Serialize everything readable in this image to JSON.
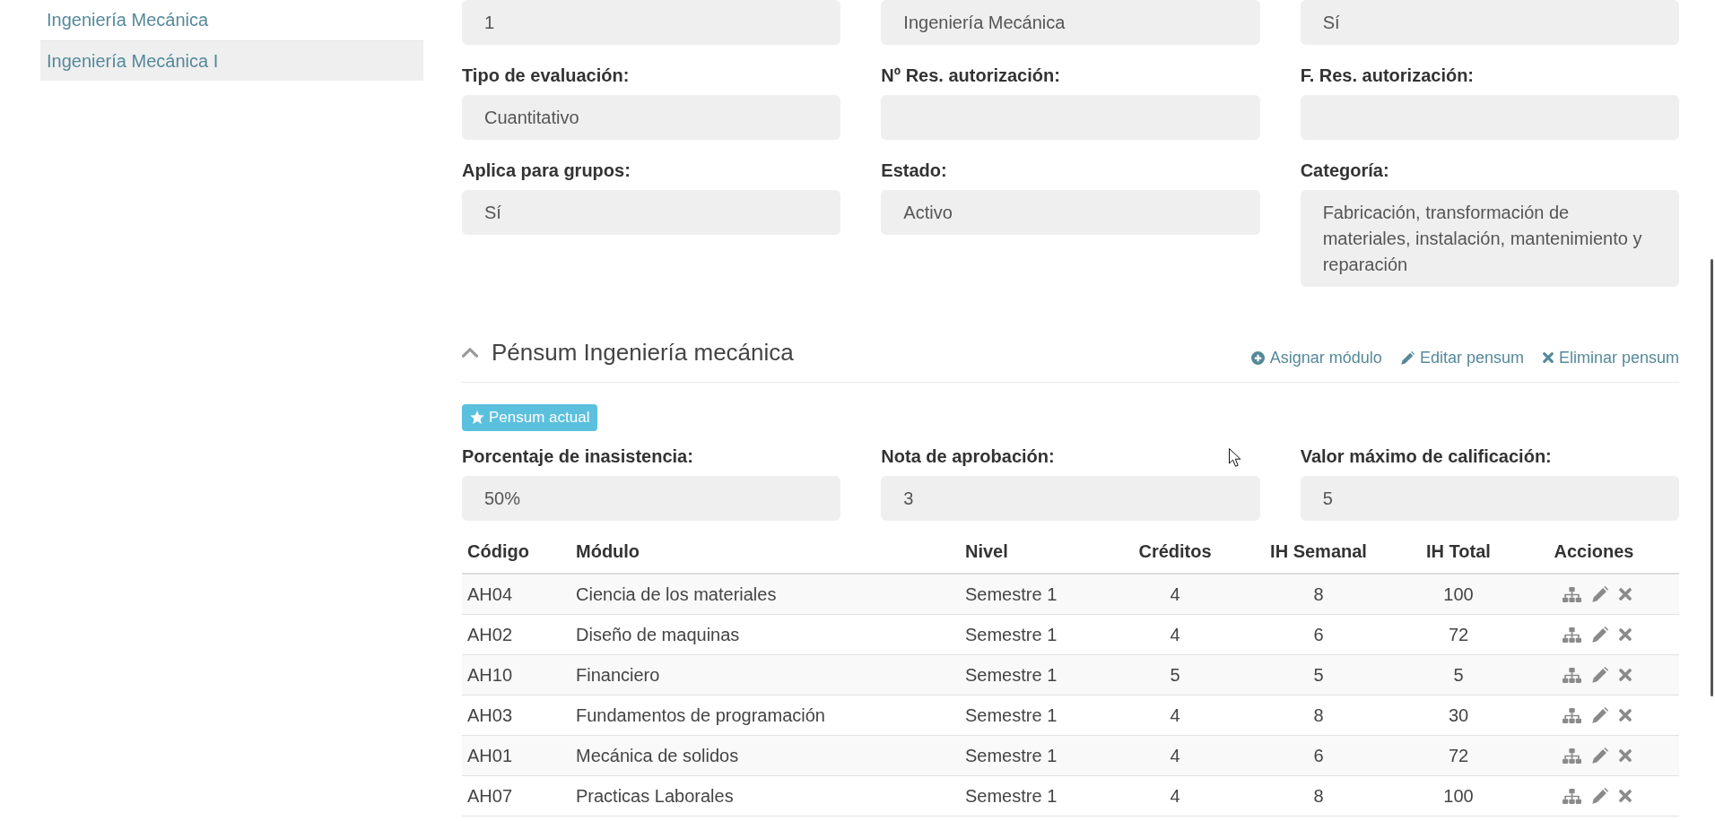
{
  "sidebar": {
    "items": [
      {
        "label": "Ingeniería Mecánica",
        "selected": false
      },
      {
        "label": "Ingeniería Mecánica I",
        "selected": true
      }
    ]
  },
  "details": {
    "fields": [
      {
        "value": "1"
      },
      {
        "value": "Ingeniería Mecánica"
      },
      {
        "value": "Sí"
      },
      {
        "label": "Tipo de evaluación:",
        "value": "Cuantitativo"
      },
      {
        "label": "Nº Res. autorización:"
      },
      {
        "label": "F. Res. autorización:"
      },
      {
        "label": "Aplica para grupos:",
        "value": "Sí"
      },
      {
        "label": "Estado:",
        "value": "Activo"
      },
      {
        "label": "Categoría:",
        "value": "Fabricación, transformación de materiales, instalación, mantenimiento y reparación"
      }
    ]
  },
  "pensum": {
    "title": "Pénsum Ingeniería mecánica",
    "expanded": true,
    "actions": [
      {
        "kind": "assign",
        "label": "Asignar módulo"
      },
      {
        "kind": "edit",
        "label": "Editar pensum"
      },
      {
        "kind": "delete",
        "label": "Eliminar pensum"
      }
    ],
    "badge": {
      "label": "Pensum actual"
    },
    "fields": [
      {
        "label": "Porcentaje de inasistencia:",
        "value": "50%"
      },
      {
        "label": "Nota de aprobación:",
        "value": "3"
      },
      {
        "label": "Valor máximo de calificación:",
        "value": "5"
      }
    ],
    "table": {
      "columns": [
        "Código",
        "Módulo",
        "Nivel",
        "Créditos",
        "IH Semanal",
        "IH Total",
        "Acciones"
      ],
      "rows": [
        {
          "cells": [
            "AH04",
            "Ciencia de los materiales",
            "Semestre 1",
            "4",
            "8",
            "100"
          ]
        },
        {
          "cells": [
            "AH02",
            "Diseño de maquinas",
            "Semestre 1",
            "4",
            "6",
            "72"
          ]
        },
        {
          "cells": [
            "AH10",
            "Financiero",
            "Semestre 1",
            "5",
            "5",
            "5"
          ]
        },
        {
          "cells": [
            "AH03",
            "Fundamentos de programación",
            "Semestre 1",
            "4",
            "8",
            "30"
          ]
        },
        {
          "cells": [
            "AH01",
            "Mecánica de solidos",
            "Semestre 1",
            "4",
            "6",
            "72"
          ]
        },
        {
          "cells": [
            "AH07",
            "Practicas Laborales",
            "Semestre 1",
            "4",
            "8",
            "100"
          ]
        }
      ]
    }
  }
}
